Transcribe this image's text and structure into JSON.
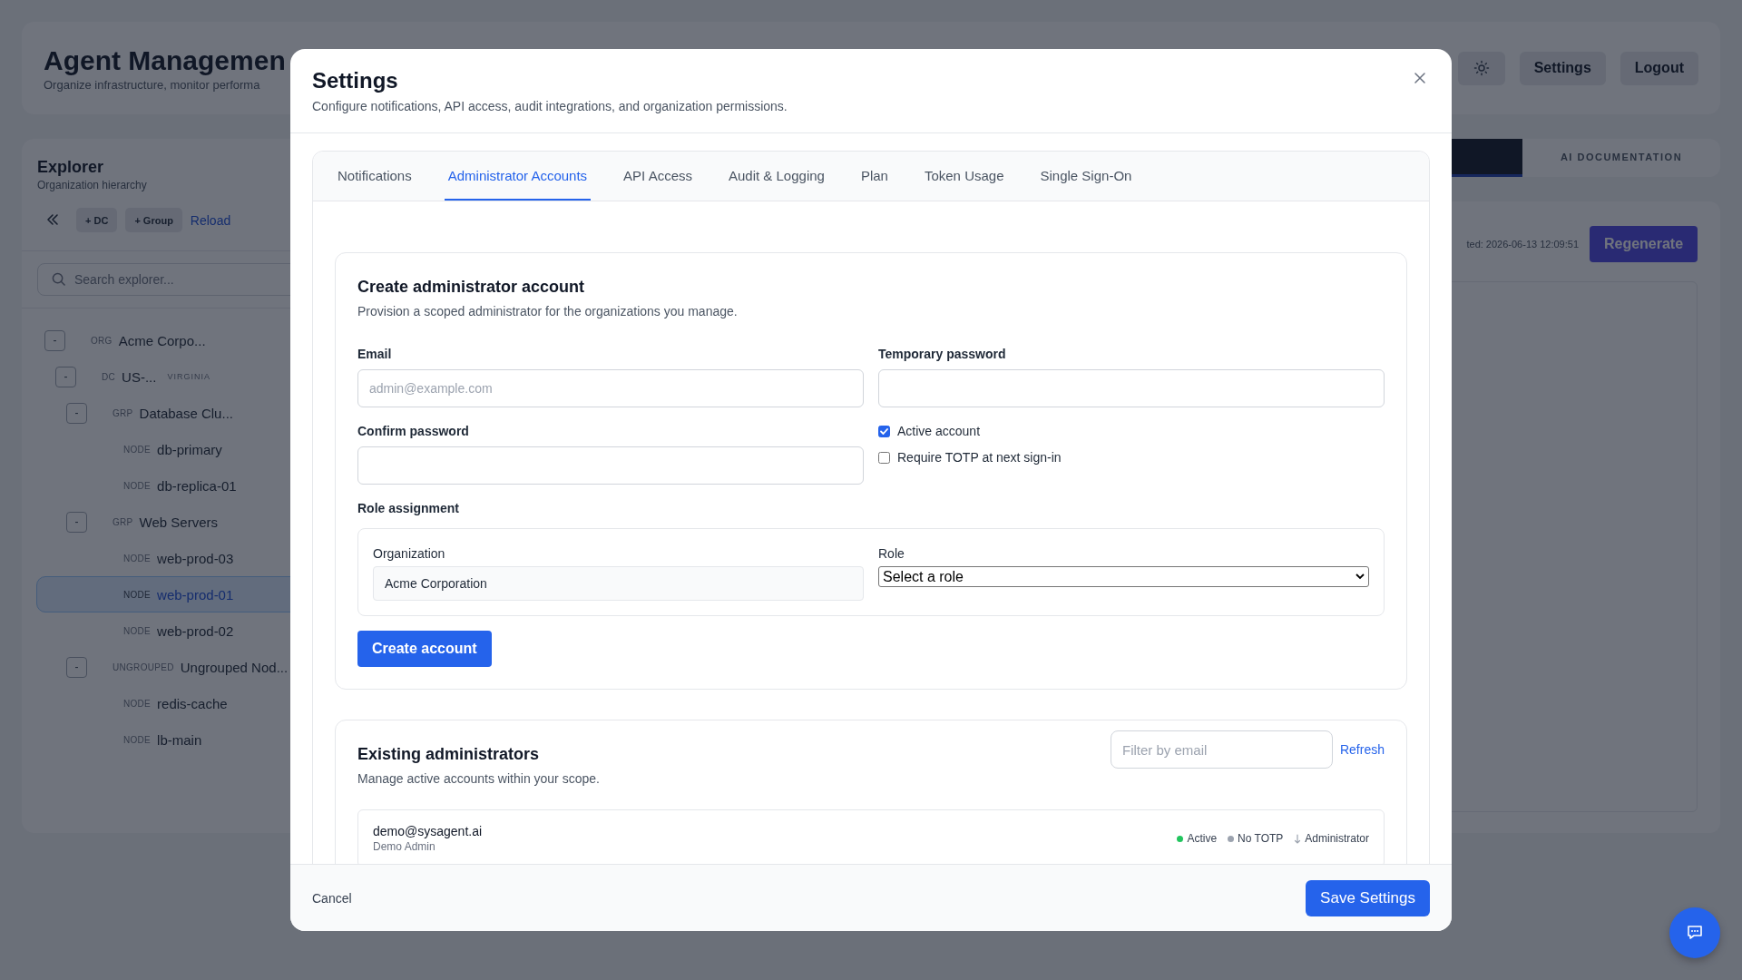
{
  "header": {
    "title": "Agent Managemen",
    "subtitle": "Organize infrastructure, monitor performa",
    "buttons": [
      "Settings",
      "Logout"
    ]
  },
  "explorer": {
    "title": "Explorer",
    "subtitle": "Organization hierarchy",
    "actions": [
      "+ DC",
      "+ Group"
    ],
    "reload": "Reload",
    "search": {
      "placeholder": "Search explorer..."
    },
    "tree": [
      {
        "tag": "ORG",
        "name": "Acme Corpo...",
        "toggle": "-",
        "selected": false,
        "children": [
          {
            "tag": "DC",
            "name": "US-...",
            "region": "VIRGINIA",
            "toggle": "-",
            "selected": false,
            "children": [
              {
                "tag": "GRP",
                "name": "Database Clu...",
                "toggle": "-",
                "selected": false,
                "children": [
                  {
                    "tag": "NODE",
                    "name": "db-primary",
                    "selected": false
                  },
                  {
                    "tag": "NODE",
                    "name": "db-replica-01",
                    "selected": false
                  }
                ]
              },
              {
                "tag": "GRP",
                "name": "Web Servers",
                "toggle": "-",
                "selected": false,
                "children": [
                  {
                    "tag": "NODE",
                    "name": "web-prod-03",
                    "selected": false
                  },
                  {
                    "tag": "NODE",
                    "name": "web-prod-01",
                    "selected": true
                  },
                  {
                    "tag": "NODE",
                    "name": "web-prod-02",
                    "selected": false
                  }
                ]
              },
              {
                "tag": "UNGROUPED",
                "name": "Ungrouped Nod...",
                "toggle": "-",
                "selected": false,
                "children": [
                  {
                    "tag": "NODE",
                    "name": "redis-cache",
                    "selected": false
                  },
                  {
                    "tag": "NODE",
                    "name": "lb-main",
                    "selected": false
                  }
                ]
              }
            ]
          }
        ]
      }
    ]
  },
  "doc_panel": {
    "tabs": [
      {
        "selected": true
      },
      {
        "label": "AI DOCUMENTATION",
        "selected": false
      }
    ],
    "generated": "ted: 2026-06-13 12:09:51",
    "regenerate": "Regenerate"
  },
  "settings": {
    "title": "Settings",
    "subtitle": "Configure notifications, API access, audit integrations, and organization permissions.",
    "tabs": [
      {
        "label": "Notifications",
        "selected": false
      },
      {
        "label": "Administrator Accounts",
        "selected": true
      },
      {
        "label": "API Access",
        "selected": false
      },
      {
        "label": "Audit & Logging",
        "selected": false
      },
      {
        "label": "Plan",
        "selected": false
      },
      {
        "label": "Token Usage",
        "selected": false
      },
      {
        "label": "Single Sign-On",
        "selected": false
      }
    ],
    "create": {
      "title": "Create administrator account",
      "subtitle": "Provision a scoped administrator for the organizations you manage.",
      "fields": [
        {
          "label": "Email",
          "placeholder": "admin@example.com"
        },
        {
          "label": "Temporary password"
        },
        {
          "label": "Confirm password"
        }
      ],
      "options": [
        {
          "label": "Active account",
          "checked": true
        },
        {
          "label": "Require TOTP at next sign-in",
          "checked": false
        }
      ],
      "role_assignment": {
        "label": "Role assignment",
        "organization": {
          "label": "Organization",
          "value": "Acme Corporation"
        },
        "role": {
          "label": "Role",
          "value": "Select a role"
        }
      },
      "button": "Create account"
    },
    "existing": {
      "title": "Existing administrators",
      "subtitle": "Manage active accounts within your scope.",
      "filter": {
        "placeholder": "Filter by email"
      },
      "refresh": "Refresh",
      "admins": [
        {
          "email": "demo@sysagent.ai",
          "name": "Demo Admin",
          "statuses": [
            {
              "label": "Active",
              "color": "#22c55e"
            },
            {
              "label": "No TOTP",
              "color": "#9ca3af"
            }
          ],
          "role": "Administrator"
        }
      ]
    },
    "cancel": "Cancel",
    "save": "Save Settings"
  }
}
